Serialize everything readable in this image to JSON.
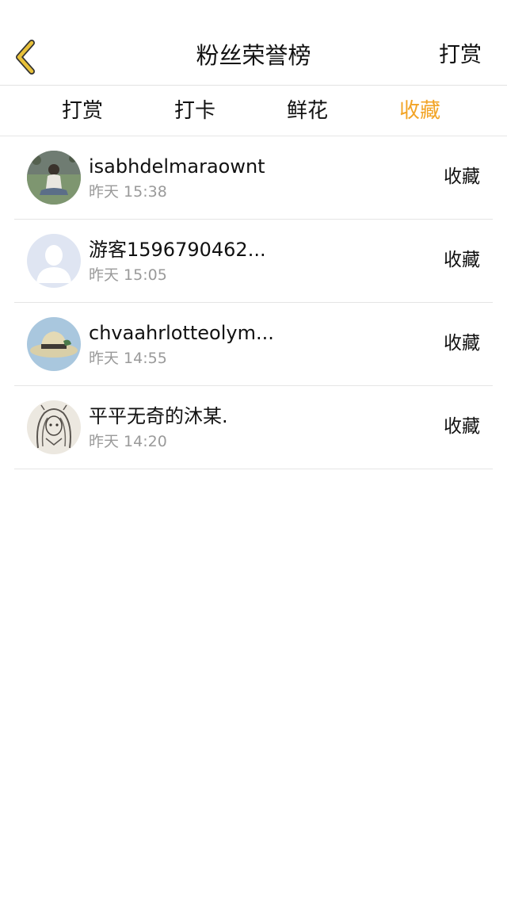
{
  "header": {
    "title": "粉丝荣誉榜",
    "action_label": "打赏",
    "back_icon": "chevron-left-icon",
    "back_color": "#e8c13a"
  },
  "tabs": [
    {
      "label": "打赏",
      "active": false
    },
    {
      "label": "打卡",
      "active": false
    },
    {
      "label": "鲜花",
      "active": false
    },
    {
      "label": "收藏",
      "active": true
    }
  ],
  "colors": {
    "accent": "#f2a426",
    "secondary_text": "#9a9a9a",
    "divider": "#e5e5e5"
  },
  "list": {
    "items": [
      {
        "name": "isabhdelmaraownt",
        "time": "昨天 15:38",
        "action": "收藏",
        "avatar": "photo-avatar-person-grass"
      },
      {
        "name": "游客1596790462...",
        "time": "昨天 15:05",
        "action": "收藏",
        "avatar": "default-avatar-silhouette"
      },
      {
        "name": "chvaahrlotteolym...",
        "time": "昨天 14:55",
        "action": "收藏",
        "avatar": "photo-avatar-straw-hat"
      },
      {
        "name": "平平无奇的沐某.",
        "time": "昨天 14:20",
        "action": "收藏",
        "avatar": "photo-avatar-sketch-girl"
      }
    ]
  }
}
